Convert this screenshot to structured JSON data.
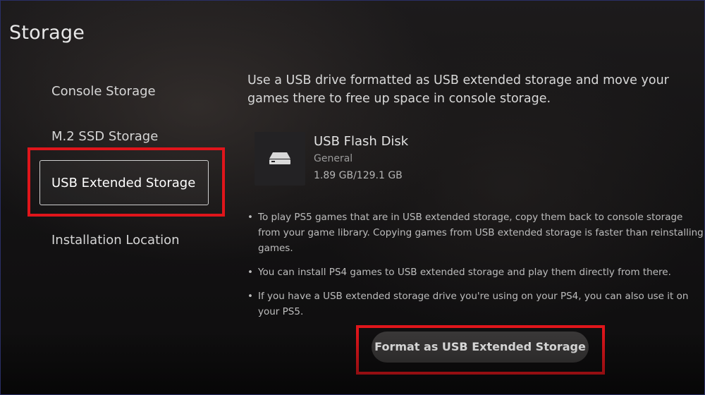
{
  "header": {
    "title": "Storage"
  },
  "sidebar": {
    "items": [
      {
        "label": "Console Storage"
      },
      {
        "label": "M.2 SSD Storage"
      },
      {
        "label": "USB Extended Storage"
      },
      {
        "label": "Installation Location"
      }
    ],
    "selected_index": 2
  },
  "main": {
    "intro_text": "Use a USB drive formatted as USB extended storage and move your games there to free up space in console storage.",
    "device": {
      "icon": "usb-drive-icon",
      "name": "USB Flash Disk",
      "type": "General",
      "size": "1.89 GB/129.1 GB"
    },
    "notes": [
      "To play PS5 games that are in USB extended storage, copy them back to console storage from your game library. Copying games from USB extended storage is faster than reinstalling games.",
      "You can install PS4 games to USB extended storage and play them directly from there.",
      "If you have a USB extended storage drive you're using on your PS4, you can also use it on your PS5."
    ],
    "bullet_glyph": "•",
    "format_button_label": "Format as USB Extended Storage"
  },
  "colors": {
    "highlight_red": "#e0151b",
    "background": "#141314",
    "button": "#3a3838"
  }
}
